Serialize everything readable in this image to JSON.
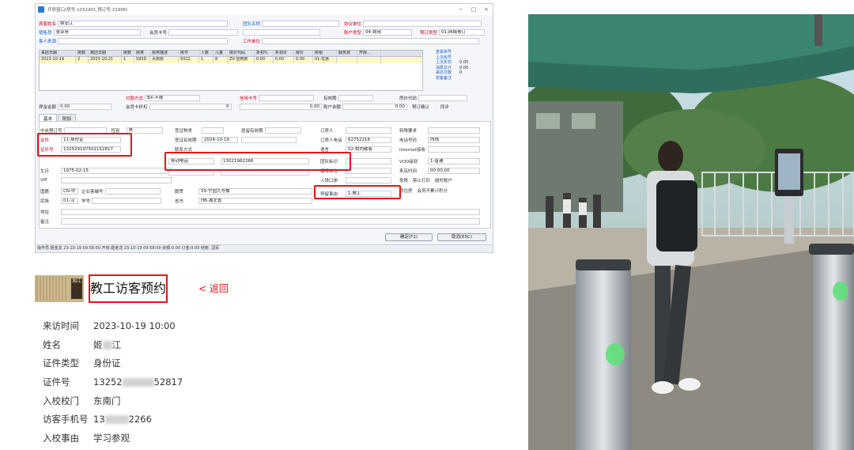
{
  "window": {
    "title": "开房窗口(房号:1032401,预订号:22998)",
    "controls": [
      "−",
      "□",
      "×"
    ]
  },
  "top_form": {
    "guest_name_label": "宾客姓名",
    "guest_name": "姬忠江",
    "group_name_label": "团队名称",
    "sales_unit_label": "协议单位",
    "salesperson_label": "销售员",
    "salesperson": "张业务",
    "member_card_label": "会员卡号",
    "account_type_label": "账户类型",
    "account_type": "04-自用",
    "booking_type_label": "预订类型",
    "booking_type": "01-网络预订",
    "guest_source_label": "客人来源",
    "guest_source": "",
    "work_unit_label": "工作单位"
  },
  "grid": {
    "headers": [
      "来店日期",
      "房数",
      "离店日期",
      "房数",
      "房类",
      "房类描述",
      "房号",
      "人数",
      "儿童",
      "房价代码",
      "折扣%",
      "折扣价",
      "房价",
      "房租",
      "服务费",
      "开房..."
    ],
    "row": [
      "2023-10-19",
      "2",
      "2023-10-21",
      "1",
      "S95D",
      "大床房",
      "9312",
      "1",
      "8",
      "ZV-自用房",
      "0.00",
      "0.00",
      "0.00",
      "01-优惠",
      "",
      ""
    ]
  },
  "side_summary": [
    {
      "k": "查看房号",
      "v": ""
    },
    {
      "k": "上次房号",
      "v": ""
    },
    {
      "k": "上次折扣",
      "v": "0.00"
    },
    {
      "k": "消费总计",
      "v": "0.00"
    },
    {
      "k": "来店次数",
      "v": "0"
    },
    {
      "k": "宾客备注",
      "v": ""
    }
  ],
  "mid_form": {
    "pay_label": "付款方式",
    "pay": "BX-不限",
    "credit_label": "信用卡号",
    "valid_label": "有效期",
    "voucher_label": "房价代码",
    "deposit_label": "押金金额",
    "deposit": "0.00",
    "member_level_label": "会员卡折扣",
    "member_level": "0",
    "amount": "0.00",
    "balance_label": "账户余额",
    "balance": "0.00",
    "confirm_label": "预订确认",
    "sync_label": "同步"
  },
  "tabs": [
    "基本",
    "附加"
  ],
  "basic": {
    "booking_no_label": "中央预订号",
    "gender_label": "性别",
    "gender": "男",
    "id_type_label": "证件",
    "id_type": "11-身份证",
    "id_no_label": "证件号",
    "id_no": "132529197502152817",
    "birthday_label": "生日",
    "birthday": "1975-02-15",
    "vip_label": "VIP",
    "nation_label": "国籍",
    "nation": "CN-中",
    "enterprise_label": "企业客编号",
    "ethnic_label": "民族",
    "ethnic": "01-汉",
    "school_label": "学号",
    "address_label": "地址",
    "remark_label": "备注",
    "visa_type_label": "签证种类",
    "visa_valid_label": "签证有效期",
    "visa_valid": "2024-10-19",
    "stay_valid_label": "居留有效期",
    "phone_type": "移动电话",
    "phone": "13021962266",
    "contact_label": "联系方式",
    "province_label": "省市",
    "province": "HB-湖北省",
    "origin_label": "籍贯",
    "origin": "59-宁园九号楼",
    "booker_label": "订房人",
    "booker_phone_label": "订房人电话",
    "booker_phone": "62752218",
    "guest_phone_label": "电话号码",
    "guest_phone": "内线",
    "language_label": "语言",
    "language": "02-校内散客",
    "internet_label": "Internet接收",
    "group_mark_label": "团队标识",
    "vod_label": "VOD级别",
    "vod": "1-普通",
    "order_unit_label": "接待单位",
    "arrival_time_label": "来店时间",
    "arrival_time": "00:00:00",
    "entry_label": "入境口岸",
    "entry_exit_label": "出入境日期",
    "stay_reason_label": "停留事由",
    "stay_reason": "1-教工",
    "free_label": "免税",
    "noprint_label": "禁止打印",
    "outer_label": "超时账户",
    "special_label": "特殊要求",
    "same_room_label": "同住房",
    "nopoint_label": "会员不累计积分"
  },
  "buttons": {
    "confirm": "确定(F2)",
    "cancel": "取消(ESC)"
  },
  "statusbar": "操作员:姬金龙 23-10-19 09:58:00   开房:姬金龙 23-10-19 09:58:00   余额:0.00   订金:0.00   结帐:   冠军",
  "visitor": {
    "logo_text": "湘江",
    "title": "教工访客预约",
    "back": "< 返回",
    "rows": [
      {
        "k": "来访时间",
        "v": "2023-10-19 10:00"
      },
      {
        "k": "姓名",
        "v": "姬",
        "v2": "江"
      },
      {
        "k": "证件类型",
        "v": "身份证"
      },
      {
        "k": "证件号",
        "v": "13252",
        "v2": "52817"
      },
      {
        "k": "入校校门",
        "v": "东南门"
      },
      {
        "k": "访客手机号",
        "v": "13",
        "v2": "2266"
      },
      {
        "k": "入校事由",
        "v": "学习参观"
      }
    ]
  },
  "colors": {
    "highlight": "#e6141a",
    "label_red": "#d0021b",
    "label_blue": "#1e5fbf"
  }
}
